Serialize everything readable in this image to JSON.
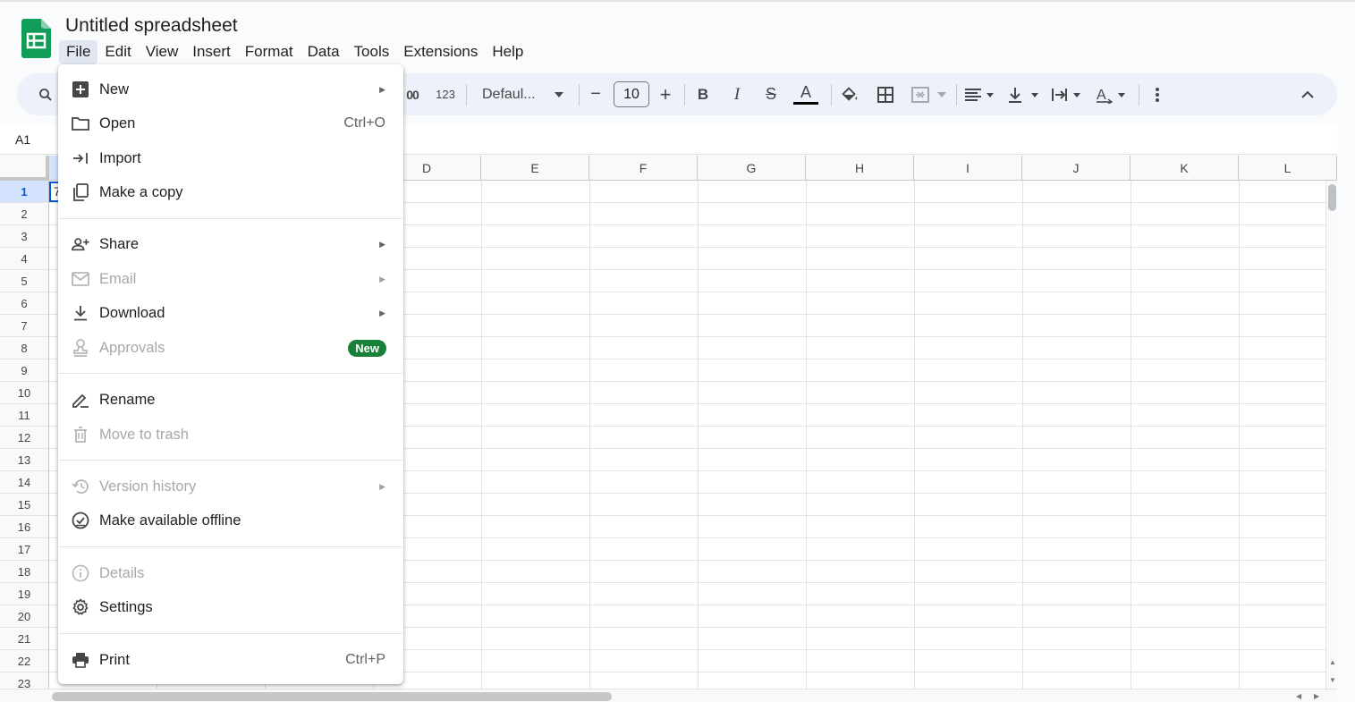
{
  "app": {
    "title": "Untitled spreadsheet"
  },
  "menubar": [
    {
      "label": "File",
      "active": true
    },
    {
      "label": "Edit"
    },
    {
      "label": "View"
    },
    {
      "label": "Insert"
    },
    {
      "label": "Format"
    },
    {
      "label": "Data"
    },
    {
      "label": "Tools"
    },
    {
      "label": "Extensions"
    },
    {
      "label": "Help"
    }
  ],
  "toolbar": {
    "decimal_partial": "00",
    "number_format": "123",
    "font": "Defaul...",
    "font_size": "10",
    "minus": "−",
    "plus": "+",
    "bold": "B",
    "italic": "I",
    "strike": "S",
    "text_color_letter": "A",
    "text_color": "#000000"
  },
  "namebox": "A1",
  "columns": [
    "D",
    "E",
    "F",
    "G",
    "H",
    "I",
    "J",
    "K",
    "L"
  ],
  "rows": [
    "1",
    "2",
    "3",
    "4",
    "5",
    "6",
    "7",
    "8",
    "9",
    "10",
    "11",
    "12",
    "13",
    "14",
    "15",
    "16",
    "17",
    "18",
    "19",
    "20",
    "21",
    "22",
    "23"
  ],
  "cell_a1": "7",
  "file_menu": {
    "items": [
      {
        "label": "New",
        "icon": "plus-box-icon",
        "arrow": true
      },
      {
        "label": "Open",
        "icon": "folder-icon",
        "shortcut": "Ctrl+O"
      },
      {
        "label": "Import",
        "icon": "import-arrow-icon"
      },
      {
        "label": "Make a copy",
        "icon": "copy-icon"
      },
      {
        "label": "Share",
        "icon": "person-add-icon",
        "arrow": true
      },
      {
        "label": "Email",
        "icon": "mail-icon",
        "arrow": true,
        "disabled": true
      },
      {
        "label": "Download",
        "icon": "download-icon",
        "arrow": true
      },
      {
        "label": "Approvals",
        "icon": "stamp-icon",
        "badge": "New",
        "disabled": true
      },
      {
        "label": "Rename",
        "icon": "rename-pencil-icon"
      },
      {
        "label": "Move to trash",
        "icon": "trash-icon",
        "disabled": true
      },
      {
        "label": "Version history",
        "icon": "history-icon",
        "arrow": true,
        "disabled": true
      },
      {
        "label": "Make available offline",
        "icon": "offline-check-icon"
      },
      {
        "label": "Details",
        "icon": "info-icon",
        "disabled": true
      },
      {
        "label": "Settings",
        "icon": "gear-icon"
      },
      {
        "label": "Print",
        "icon": "printer-icon",
        "shortcut": "Ctrl+P"
      }
    ]
  },
  "colors": {
    "brand_green": "#0f9d58",
    "badge_green": "#188038",
    "selection_blue": "#0b57d0"
  }
}
